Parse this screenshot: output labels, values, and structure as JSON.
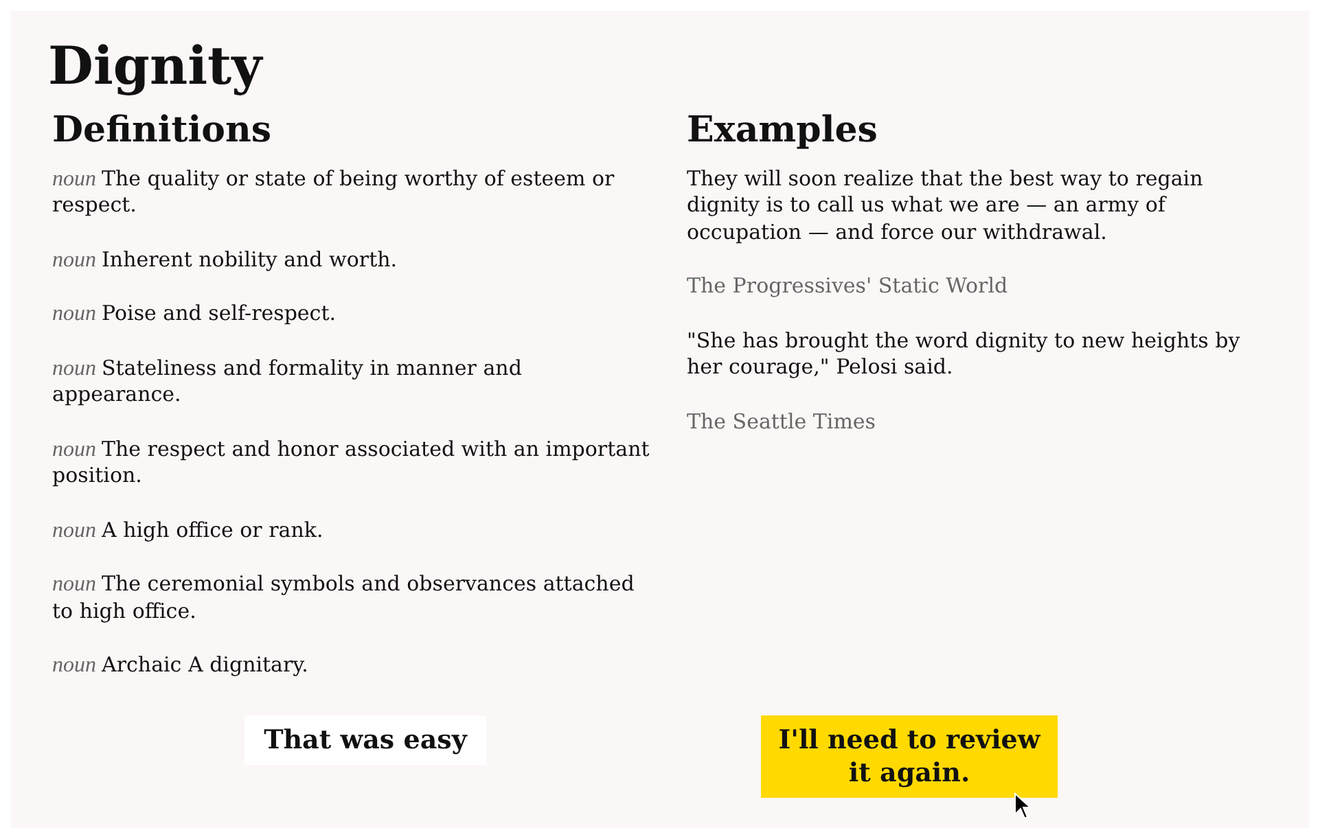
{
  "word": "Dignity",
  "definitions": {
    "heading": "Definitions",
    "items": [
      {
        "pos": "noun",
        "text": "The quality or state of being worthy of esteem or respect."
      },
      {
        "pos": "noun",
        "text": "Inherent nobility and worth."
      },
      {
        "pos": "noun",
        "text": "Poise and self-respect."
      },
      {
        "pos": "noun",
        "text": "Stateliness and formality in manner and appearance."
      },
      {
        "pos": "noun",
        "text": "The respect and honor associated with an important position."
      },
      {
        "pos": "noun",
        "text": "A high office or rank."
      },
      {
        "pos": "noun",
        "text": "The ceremonial symbols and observances attached to high office."
      },
      {
        "pos": "noun",
        "text": "Archaic A dignitary."
      }
    ]
  },
  "examples": {
    "heading": "Examples",
    "items": [
      {
        "quote": "They will soon realize that the best way to regain dignity is to call us what we are — an army of occupation — and force our withdrawal.",
        "source": "The Progressives' Static World"
      },
      {
        "quote": "\"She has brought the word dignity to new heights by her courage,\" Pelosi said.",
        "source": "The Seattle Times"
      }
    ]
  },
  "buttons": [
    {
      "label": "That was easy",
      "hovered": false
    },
    {
      "label": "I'll need to review it again.",
      "hovered": true
    }
  ]
}
